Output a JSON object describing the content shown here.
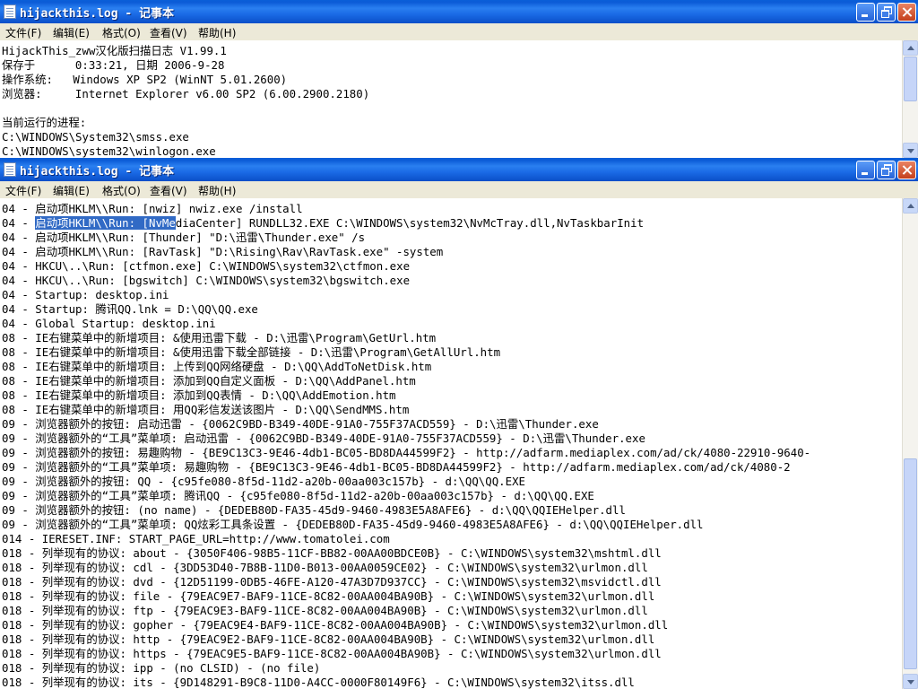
{
  "windows": [
    {
      "title": "hijackthis.log - 记事本",
      "menu": [
        "文件(F)",
        "编辑(E)",
        "格式(O)",
        "查看(V)",
        "帮助(H)"
      ],
      "lines": [
        "HijackThis_zww汉化版扫描日志 V1.99.1",
        "保存于      0:33:21, 日期 2006-9-28",
        "操作系统:   Windows XP SP2 (WinNT 5.01.2600)",
        "浏览器:     Internet Explorer v6.00 SP2 (6.00.2900.2180)",
        "",
        "当前运行的进程:",
        "C:\\WINDOWS\\System32\\smss.exe",
        "C:\\WINDOWS\\system32\\winlogon.exe"
      ]
    },
    {
      "title": "hijackthis.log - 记事本",
      "menu": [
        "文件(F)",
        "编辑(E)",
        "格式(O)",
        "查看(V)",
        "帮助(H)"
      ],
      "selected_line": {
        "prefix": "04 - ",
        "selected": "启动项HKLM\\\\Run: [NvMe",
        "rest": "diaCenter] RUNDLL32.EXE C:\\WINDOWS\\system32\\NvMcTray.dll,NvTaskbarInit"
      },
      "lines": [
        "04 - 启动项HKLM\\\\Run: [nwiz] nwiz.exe /install",
        "",
        "04 - 启动项HKLM\\\\Run: [Thunder] \"D:\\迅雷\\Thunder.exe\" /s",
        "04 - 启动项HKLM\\\\Run: [RavTask] \"D:\\Rising\\Rav\\RavTask.exe\" -system",
        "04 - HKCU\\..\\Run: [ctfmon.exe] C:\\WINDOWS\\system32\\ctfmon.exe",
        "04 - HKCU\\..\\Run: [bgswitch] C:\\WINDOWS\\system32\\bgswitch.exe",
        "04 - Startup: desktop.ini",
        "04 - Startup: 腾讯QQ.lnk = D:\\QQ\\QQ.exe",
        "04 - Global Startup: desktop.ini",
        "08 - IE右键菜单中的新增项目: &使用迅雷下载 - D:\\迅雷\\Program\\GetUrl.htm",
        "08 - IE右键菜单中的新增项目: &使用迅雷下载全部链接 - D:\\迅雷\\Program\\GetAllUrl.htm",
        "08 - IE右键菜单中的新增项目: 上传到QQ网络硬盘 - D:\\QQ\\AddToNetDisk.htm",
        "08 - IE右键菜单中的新增项目: 添加到QQ自定义面板 - D:\\QQ\\AddPanel.htm",
        "08 - IE右键菜单中的新增项目: 添加到QQ表情 - D:\\QQ\\AddEmotion.htm",
        "08 - IE右键菜单中的新增项目: 用QQ彩信发送该图片 - D:\\QQ\\SendMMS.htm",
        "09 - 浏览器额外的按钮: 启动迅雷 - {0062C9BD-B349-40DE-91A0-755F37ACD559} - D:\\迅雷\\Thunder.exe",
        "09 - 浏览器额外的“工具”菜单项: 启动迅雷 - {0062C9BD-B349-40DE-91A0-755F37ACD559} - D:\\迅雷\\Thunder.exe",
        "09 - 浏览器额外的按钮: 易趣购物 - {BE9C13C3-9E46-4db1-BC05-BD8DA44599F2} - http://adfarm.mediaplex.com/ad/ck/4080-22910-9640-",
        "09 - 浏览器额外的“工具”菜单项: 易趣购物 - {BE9C13C3-9E46-4db1-BC05-BD8DA44599F2} - http://adfarm.mediaplex.com/ad/ck/4080-2",
        "09 - 浏览器额外的按钮: QQ - {c95fe080-8f5d-11d2-a20b-00aa003c157b} - d:\\QQ\\QQ.EXE",
        "09 - 浏览器额外的“工具”菜单项: 腾讯QQ - {c95fe080-8f5d-11d2-a20b-00aa003c157b} - d:\\QQ\\QQ.EXE",
        "09 - 浏览器额外的按钮: (no name) - {DEDEB80D-FA35-45d9-9460-4983E5A8AFE6} - d:\\QQ\\QQIEHelper.dll",
        "09 - 浏览器额外的“工具”菜单项: QQ炫彩工具条设置 - {DEDEB80D-FA35-45d9-9460-4983E5A8AFE6} - d:\\QQ\\QQIEHelper.dll",
        "014 - IERESET.INF: START_PAGE_URL=http://www.tomatolei.com",
        "018 - 列举现有的协议: about - {3050F406-98B5-11CF-BB82-00AA00BDCE0B} - C:\\WINDOWS\\system32\\mshtml.dll",
        "018 - 列举现有的协议: cdl - {3DD53D40-7B8B-11D0-B013-00AA0059CE02} - C:\\WINDOWS\\system32\\urlmon.dll",
        "018 - 列举现有的协议: dvd - {12D51199-0DB5-46FE-A120-47A3D7D937CC} - C:\\WINDOWS\\system32\\msvidctl.dll",
        "018 - 列举现有的协议: file - {79EAC9E7-BAF9-11CE-8C82-00AA004BA90B} - C:\\WINDOWS\\system32\\urlmon.dll",
        "018 - 列举现有的协议: ftp - {79EAC9E3-BAF9-11CE-8C82-00AA004BA90B} - C:\\WINDOWS\\system32\\urlmon.dll",
        "018 - 列举现有的协议: gopher - {79EAC9E4-BAF9-11CE-8C82-00AA004BA90B} - C:\\WINDOWS\\system32\\urlmon.dll",
        "018 - 列举现有的协议: http - {79EAC9E2-BAF9-11CE-8C82-00AA004BA90B} - C:\\WINDOWS\\system32\\urlmon.dll",
        "018 - 列举现有的协议: https - {79EAC9E5-BAF9-11CE-8C82-00AA004BA90B} - C:\\WINDOWS\\system32\\urlmon.dll",
        "018 - 列举现有的协议: ipp - (no CLSID) - (no file)",
        "018 - 列举现有的协议: its - {9D148291-B9C8-11D0-A4CC-0000F80149F6} - C:\\WINDOWS\\system32\\itss.dll"
      ]
    }
  ],
  "colors": {
    "title_bar": "#0b5bd6",
    "selection": "#316ac5",
    "chrome": "#ece9d8"
  }
}
